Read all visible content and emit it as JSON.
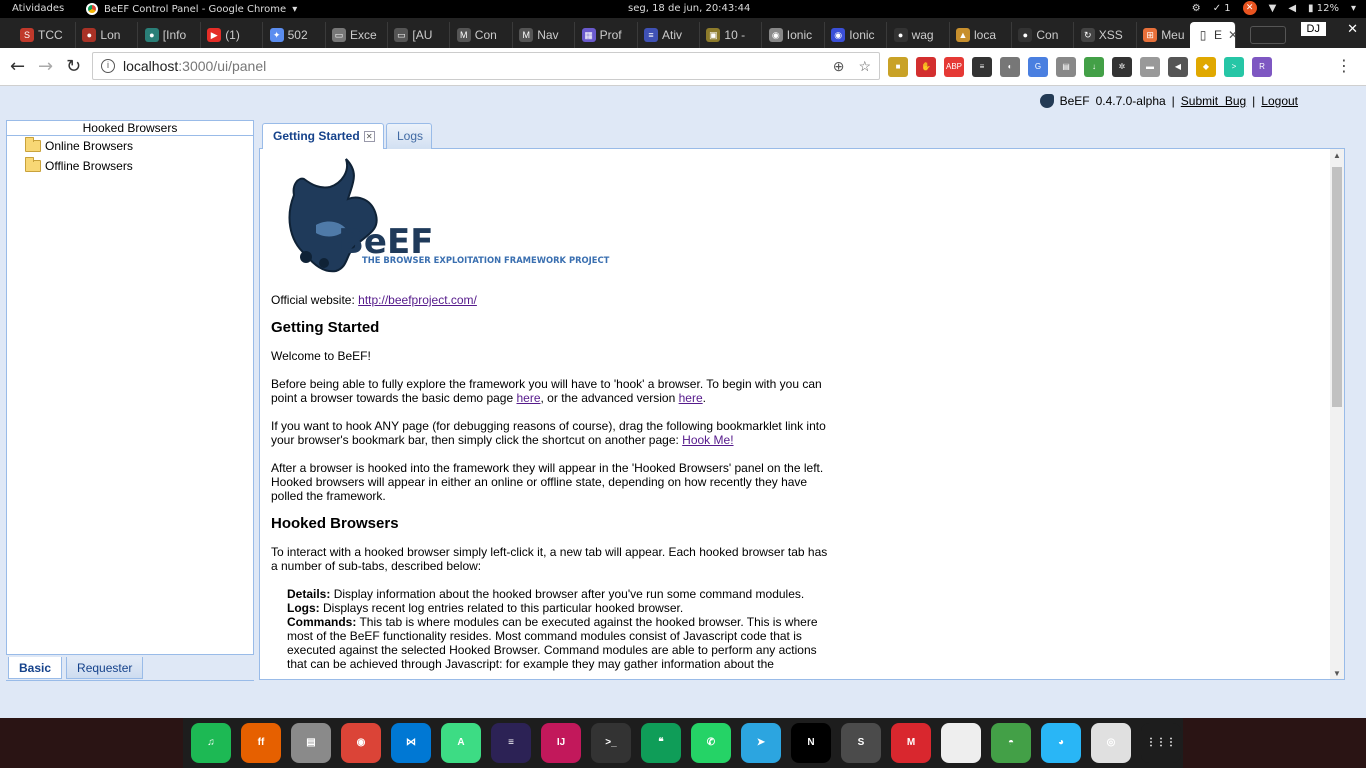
{
  "system_bar": {
    "activities": "Atividades",
    "app_name": "BeEF Control Panel - Google Chrome",
    "clock": "seg, 18 de jun, 20:43:44",
    "update_count": "1",
    "battery": "12%"
  },
  "browser_tabs": [
    {
      "label": "TCC",
      "color": "#c0392b",
      "glyph": "S"
    },
    {
      "label": "Lon",
      "color": "#a93226",
      "glyph": "●"
    },
    {
      "label": "[Info",
      "color": "#2a7f78",
      "glyph": "●"
    },
    {
      "label": "(1)",
      "color": "#e52d27",
      "glyph": "▶"
    },
    {
      "label": "502",
      "color": "#5b8def",
      "glyph": "✦"
    },
    {
      "label": "Exce",
      "color": "#777777",
      "glyph": "▭"
    },
    {
      "label": "[AU",
      "color": "#555555",
      "glyph": "▭"
    },
    {
      "label": "Con",
      "color": "#555555",
      "glyph": "M"
    },
    {
      "label": "Nav",
      "color": "#555555",
      "glyph": "M"
    },
    {
      "label": "Prof",
      "color": "#6a5acd",
      "glyph": "▦"
    },
    {
      "label": "Ativ",
      "color": "#3f51b5",
      "glyph": "≡"
    },
    {
      "label": "10 -",
      "color": "#8d7b2b",
      "glyph": "▣"
    },
    {
      "label": "Ionic",
      "color": "#888888",
      "glyph": "◉"
    },
    {
      "label": "Ionic",
      "color": "#3a4fd8",
      "glyph": "◉"
    },
    {
      "label": "wag",
      "color": "#333333",
      "glyph": "●"
    },
    {
      "label": "loca",
      "color": "#c78f2d",
      "glyph": "▲"
    },
    {
      "label": "Con",
      "color": "#333333",
      "glyph": "●"
    },
    {
      "label": "XSS",
      "color": "#444444",
      "glyph": "↻"
    },
    {
      "label": "Meu",
      "color": "#e8703a",
      "glyph": "⊞"
    }
  ],
  "active_tab": {
    "label": "E"
  },
  "profile": "DJ",
  "address": {
    "host": "localhost",
    "path": ":3000/ui/panel"
  },
  "extensions": [
    {
      "name": "ext-1-icon",
      "color": "#c9a227",
      "glyph": "■"
    },
    {
      "name": "ext-stop-icon",
      "color": "#d32f2f",
      "glyph": "✋"
    },
    {
      "name": "adblock-icon",
      "color": "#e53935",
      "glyph": "ABP"
    },
    {
      "name": "flag-icon",
      "color": "#333333",
      "glyph": "≡"
    },
    {
      "name": "ext-bulb-icon",
      "color": "#777777",
      "glyph": "◐"
    },
    {
      "name": "translate-icon",
      "color": "#4a7fe0",
      "glyph": "G"
    },
    {
      "name": "ext-chart-icon",
      "color": "#888888",
      "glyph": "▤"
    },
    {
      "name": "download-icon",
      "color": "#43a047",
      "glyph": "↓"
    },
    {
      "name": "ext-gear-icon",
      "color": "#333333",
      "glyph": "✲"
    },
    {
      "name": "ext-box-icon",
      "color": "#999999",
      "glyph": "▬"
    },
    {
      "name": "ext-sound-icon",
      "color": "#555555",
      "glyph": "◀"
    },
    {
      "name": "ext-tag-icon",
      "color": "#e0a800",
      "glyph": "◆"
    },
    {
      "name": "ext-terminal-icon",
      "color": "#26c6a6",
      "glyph": ">"
    },
    {
      "name": "ext-r-icon",
      "color": "#7e57c2",
      "glyph": "R"
    }
  ],
  "beef": {
    "header": {
      "brand": "BeEF",
      "version": "0.4.7.0-alpha",
      "sep1": "|",
      "submit_bug": "Submit  Bug",
      "sep2": "|",
      "logout": "Logout"
    },
    "left_panel": {
      "title": "Hooked Browsers",
      "items": [
        "Online Browsers",
        "Offline Browsers"
      ],
      "bottom_tabs": [
        "Basic",
        "Requester"
      ]
    },
    "main_tabs": [
      "Getting Started",
      "Logs"
    ],
    "logo": {
      "name": "BeEF",
      "tagline": "THE BROWSER EXPLOITATION FRAMEWORK PROJECT"
    },
    "content": {
      "official_label": "Official website: ",
      "official_link": "http://beefproject.com/",
      "h_getting_started": "Getting Started",
      "welcome": "Welcome to BeEF!",
      "p1_a": "Before being able to fully explore the framework you will have to 'hook' a browser. To begin with you can point a browser towards the basic demo page ",
      "p1_link1": "here",
      "p1_b": ", or the advanced version ",
      "p1_link2": "here",
      "p1_c": ".",
      "p2_a": "If you want to hook ANY page (for debugging reasons of course), drag the following bookmarklet link into your browser's bookmark bar, then simply click the shortcut on another page: ",
      "p2_link": "Hook Me!",
      "p3": "After a browser is hooked into the framework they will appear in the 'Hooked Browsers' panel on the left. Hooked browsers will appear in either an online or offline state, depending on how recently they have polled the framework.",
      "h_hooked": "Hooked Browsers",
      "p4": "To interact with a hooked browser simply left-click it, a new tab will appear. Each hooked browser tab has a number of sub-tabs, described below:",
      "details_term": "Details:",
      "details_desc": " Display information about the hooked browser after you've run some command modules.",
      "logs_term": "Logs:",
      "logs_desc": " Displays recent log entries related to this particular hooked browser.",
      "commands_term": "Commands:",
      "commands_desc": " This tab is where modules can be executed against the hooked browser. This is where most of the BeEF functionality resides. Most command modules consist of Javascript code that is executed against the selected Hooked Browser. Command modules are able to perform any actions that can be achieved through Javascript: for example they may gather information about the"
    }
  },
  "dock": [
    {
      "name": "spotify-icon",
      "color": "#1db954",
      "glyph": "♫"
    },
    {
      "name": "firefox-icon",
      "color": "#e66000",
      "glyph": "ff"
    },
    {
      "name": "files-icon",
      "color": "#8a8a8a",
      "glyph": "▤"
    },
    {
      "name": "chrome-icon",
      "color": "#db4437",
      "glyph": "◉"
    },
    {
      "name": "vscode-icon",
      "color": "#0078d4",
      "glyph": "⋈"
    },
    {
      "name": "android-studio-icon",
      "color": "#3ddc84",
      "glyph": "A"
    },
    {
      "name": "eclipse-icon",
      "color": "#2c2255",
      "glyph": "≡"
    },
    {
      "name": "intellij-icon",
      "color": "#c2185b",
      "glyph": "IJ"
    },
    {
      "name": "terminal-icon",
      "color": "#333333",
      "glyph": ">_"
    },
    {
      "name": "hangouts-icon",
      "color": "#0f9d58",
      "glyph": "❝"
    },
    {
      "name": "whatsapp-icon",
      "color": "#25d366",
      "glyph": "✆"
    },
    {
      "name": "telegram-icon",
      "color": "#2ca5e0",
      "glyph": "➤"
    },
    {
      "name": "netflix-icon",
      "color": "#000000",
      "glyph": "N"
    },
    {
      "name": "sublime-icon",
      "color": "#4b4b4b",
      "glyph": "S"
    },
    {
      "name": "mega-icon",
      "color": "#d9272e",
      "glyph": "M"
    },
    {
      "name": "document-icon",
      "color": "#eeeeee",
      "glyph": ""
    },
    {
      "name": "turtle-icon",
      "color": "#43a047",
      "glyph": "◓"
    },
    {
      "name": "elephant-icon",
      "color": "#29b6f6",
      "glyph": "◕"
    },
    {
      "name": "viewer-icon",
      "color": "#e0e0e0",
      "glyph": "◎"
    },
    {
      "name": "app-grid-icon",
      "color": "#1d1d1d",
      "glyph": "⋮⋮⋮"
    }
  ]
}
